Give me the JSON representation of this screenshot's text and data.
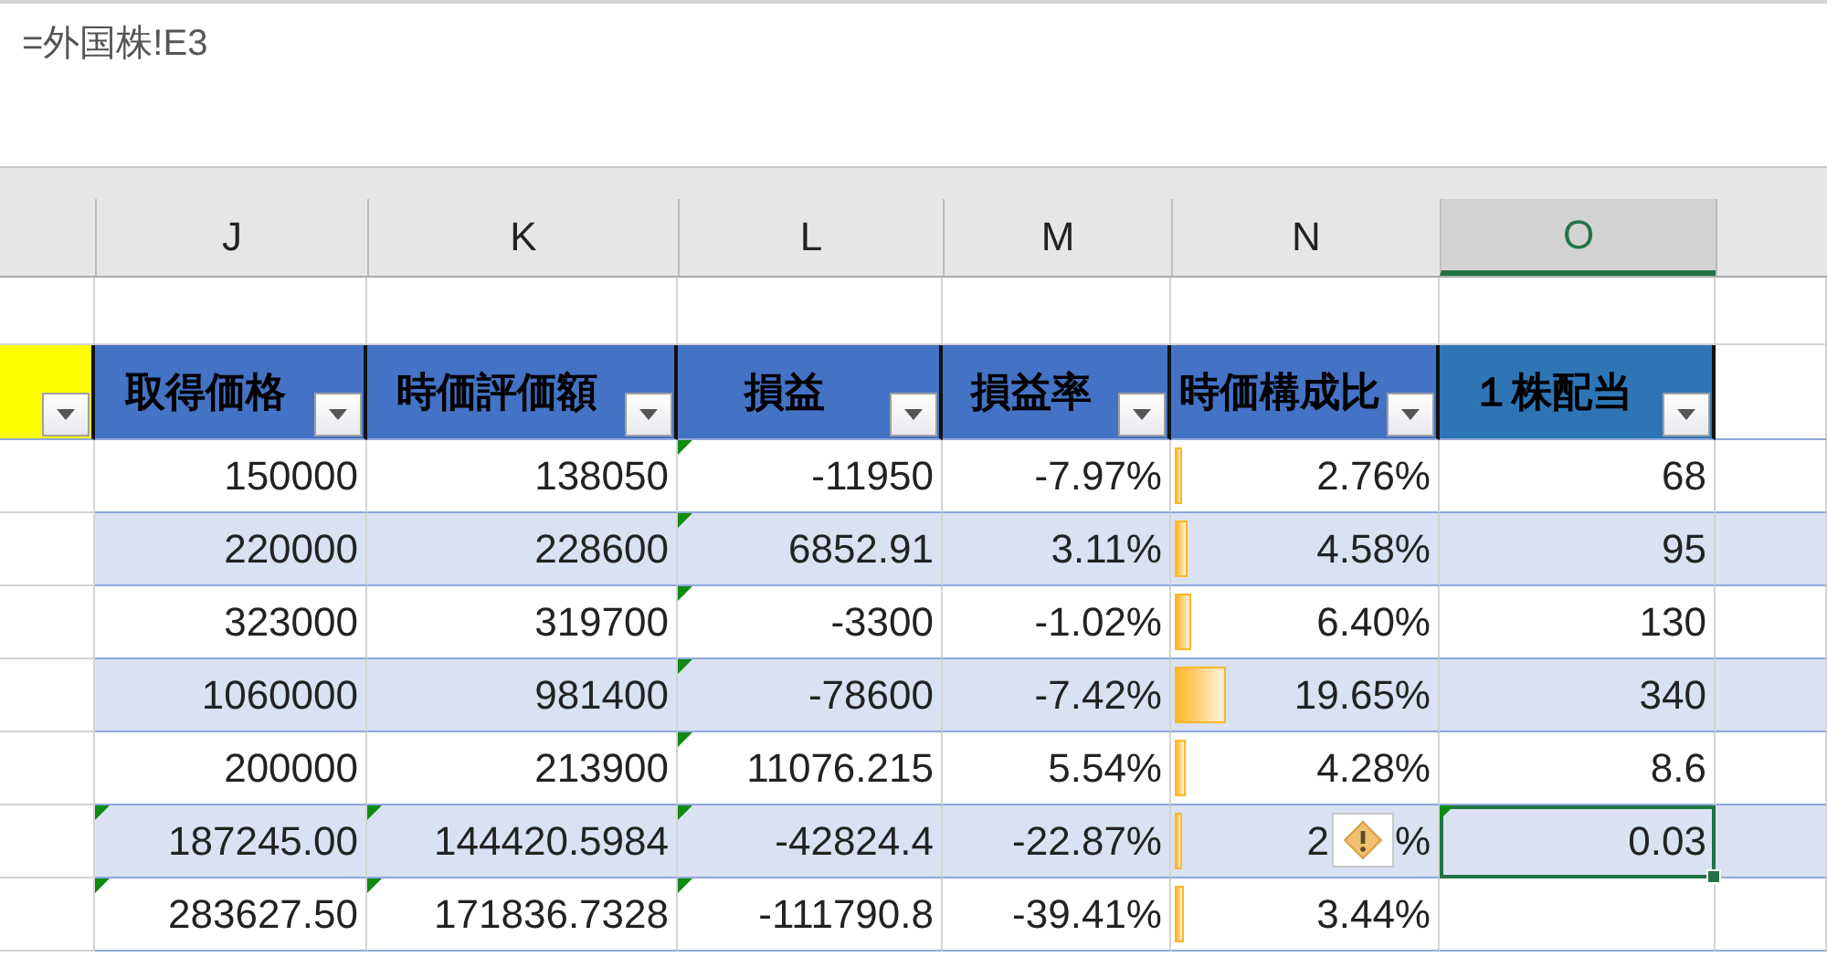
{
  "formula_bar": {
    "formula": "=外国株!E3"
  },
  "columns": [
    {
      "label": "J",
      "selected": false
    },
    {
      "label": "K",
      "selected": false
    },
    {
      "label": "L",
      "selected": false
    },
    {
      "label": "M",
      "selected": false
    },
    {
      "label": "N",
      "selected": false
    },
    {
      "label": "O",
      "selected": true
    }
  ],
  "header_cells": [
    {
      "color": "#ffff00",
      "filter": true
    },
    {
      "label": "取得価格",
      "color": "#4472c4",
      "filter": true
    },
    {
      "label": "時価評価額",
      "color": "#4472c4",
      "filter": true
    },
    {
      "label": "損益",
      "color": "#4472c4",
      "filter": true
    },
    {
      "label": "損益率",
      "color": "#4472c4",
      "filter": true
    },
    {
      "label": "時価構成比",
      "color": "#4472c4",
      "filter": true
    },
    {
      "label": "１株配当",
      "color": "#2e75b6",
      "filter": true
    }
  ],
  "rows": [
    {
      "cells": [
        {
          "text": "150000",
          "flag": false,
          "selected": false
        },
        {
          "text": "138050",
          "flag": false,
          "selected": false
        },
        {
          "text": "-11950",
          "flag": true,
          "selected": false
        },
        {
          "text": "-7.97%",
          "flag": false,
          "selected": false
        },
        {
          "text": "2.76%",
          "level": 0.028,
          "flag": false,
          "selected": false
        },
        {
          "text": "68",
          "flag": false,
          "selected": false
        }
      ]
    },
    {
      "cells": [
        {
          "text": "220000",
          "flag": false,
          "selected": false
        },
        {
          "text": "228600",
          "flag": false,
          "selected": false
        },
        {
          "text": "6852.91",
          "flag": true,
          "selected": false
        },
        {
          "text": "3.11%",
          "flag": false,
          "selected": false
        },
        {
          "text": "4.58%",
          "level": 0.046,
          "flag": false,
          "selected": false
        },
        {
          "text": "95",
          "flag": false,
          "selected": false
        }
      ]
    },
    {
      "cells": [
        {
          "text": "323000",
          "flag": false,
          "selected": false
        },
        {
          "text": "319700",
          "flag": false,
          "selected": false
        },
        {
          "text": "-3300",
          "flag": true,
          "selected": false
        },
        {
          "text": "-1.02%",
          "flag": false,
          "selected": false
        },
        {
          "text": "6.40%",
          "level": 0.064,
          "flag": false,
          "selected": false
        },
        {
          "text": "130",
          "flag": false,
          "selected": false
        }
      ]
    },
    {
      "cells": [
        {
          "text": "1060000",
          "flag": false,
          "selected": false
        },
        {
          "text": "981400",
          "flag": false,
          "selected": false
        },
        {
          "text": "-78600",
          "flag": true,
          "selected": false
        },
        {
          "text": "-7.42%",
          "flag": false,
          "selected": false
        },
        {
          "text": "19.65%",
          "level": 0.19,
          "flag": false,
          "selected": false
        },
        {
          "text": "340",
          "flag": false,
          "selected": false
        }
      ]
    },
    {
      "cells": [
        {
          "text": "200000",
          "flag": false,
          "selected": false
        },
        {
          "text": "213900",
          "flag": false,
          "selected": false
        },
        {
          "text": "11076.215",
          "flag": true,
          "selected": false
        },
        {
          "text": "5.54%",
          "flag": false,
          "selected": false
        },
        {
          "text": "4.28%",
          "level": 0.043,
          "flag": false,
          "selected": false
        },
        {
          "text": "8.6",
          "flag": false,
          "selected": false
        }
      ]
    },
    {
      "cells": [
        {
          "text": "187245.00",
          "flag": true,
          "selected": false
        },
        {
          "text": "144420.5984",
          "flag": true,
          "selected": false
        },
        {
          "text": "-42824.4",
          "flag": true,
          "selected": false
        },
        {
          "text": "-22.87%",
          "flag": false,
          "selected": false
        },
        {
          "text": "2",
          "text_after": "%",
          "warning": true,
          "level": 0.025,
          "flag": false,
          "selected": false
        },
        {
          "text": "0.03",
          "flag": true,
          "selected": true
        }
      ]
    },
    {
      "cells": [
        {
          "text": "283627.50",
          "flag": true,
          "selected": false
        },
        {
          "text": "171836.7328",
          "flag": true,
          "selected": false
        },
        {
          "text": "-111790.8",
          "flag": true,
          "selected": false
        },
        {
          "text": "-39.41%",
          "flag": false,
          "selected": false
        },
        {
          "text": "3.44%",
          "level": 0.034,
          "flag": false,
          "selected": false
        }
      ]
    }
  ]
}
